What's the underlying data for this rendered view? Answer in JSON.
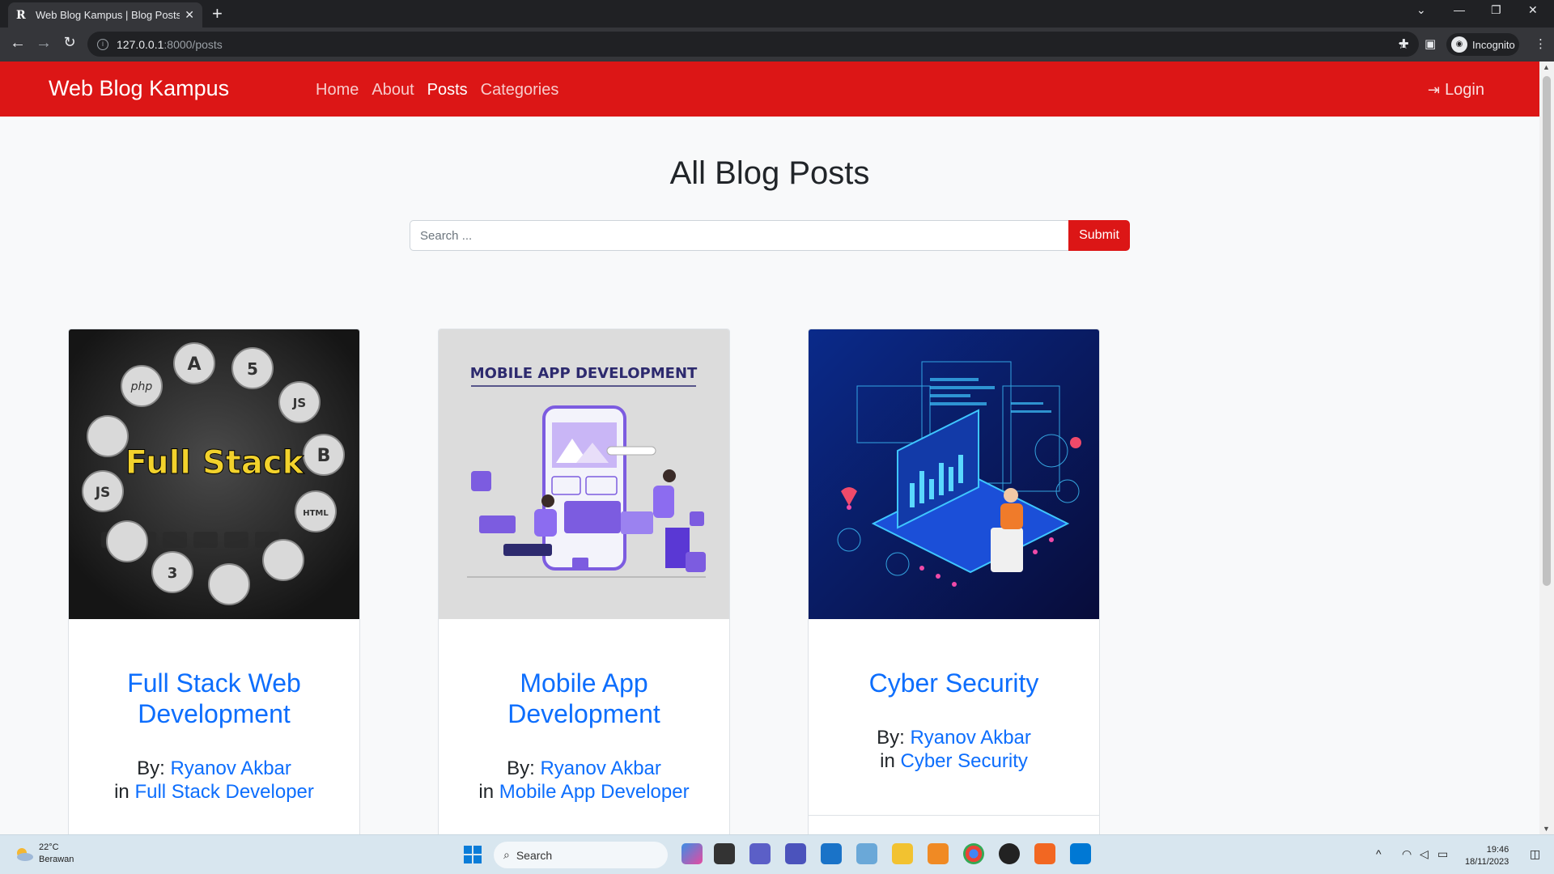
{
  "browser": {
    "tab_title": "Web Blog Kampus | Blog Posts",
    "favicon_letter": "R",
    "url_host": "127.0.0.1",
    "url_rest": ":8000/posts",
    "profile_label": "Incognito"
  },
  "site": {
    "brand": "Web Blog Kampus",
    "nav": [
      {
        "label": "Home",
        "active": false
      },
      {
        "label": "About",
        "active": false
      },
      {
        "label": "Posts",
        "active": true
      },
      {
        "label": "Categories",
        "active": false
      }
    ],
    "login_label": "Login"
  },
  "page": {
    "title": "All Blog Posts",
    "search_placeholder": "Search ...",
    "submit_label": "Submit"
  },
  "posts": [
    {
      "title": "Full Stack Web Development",
      "by_label": "By:",
      "author": "Ryanov Akbar",
      "in_label": "in",
      "category": "Full Stack Developer",
      "image_text": "Full Stack",
      "badges": [
        "php",
        "A",
        "5",
        "JS",
        "B",
        "HTML",
        "JS",
        "3"
      ]
    },
    {
      "title": "Mobile App Development",
      "by_label": "By:",
      "author": "Ryanov Akbar",
      "in_label": "in",
      "category": "Mobile App Developer",
      "image_text": "MOBILE APP DEVELOPMENT"
    },
    {
      "title": "Cyber Security",
      "by_label": "By:",
      "author": "Ryanov Akbar",
      "in_label": "in",
      "category": "Cyber Security"
    }
  ],
  "taskbar": {
    "temperature": "22°C",
    "weather": "Berawan",
    "search_label": "Search",
    "time": "19:46",
    "date": "18/11/2023"
  },
  "colors": {
    "navbar": "#dc1616",
    "link": "#0d6efd",
    "submit": "#dc1616"
  }
}
